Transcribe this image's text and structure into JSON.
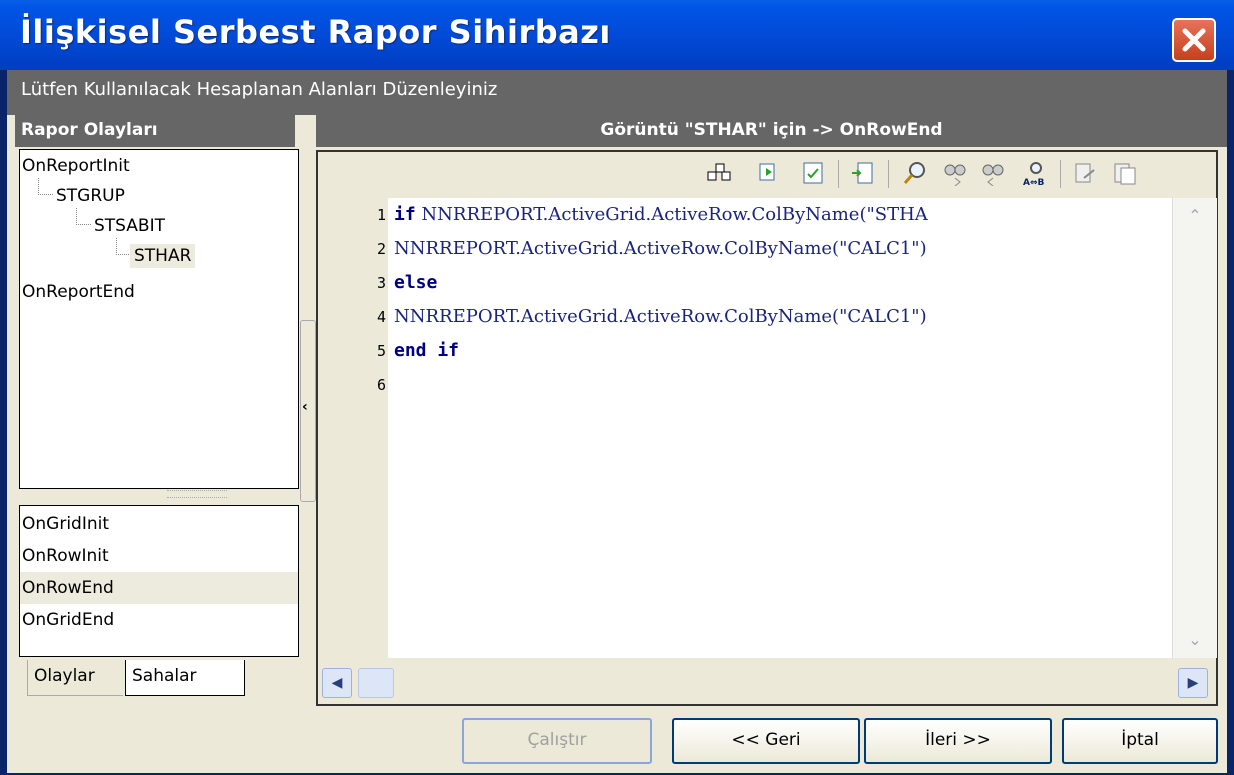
{
  "window": {
    "title": "İlişkisel Serbest Rapor Sihirbazı",
    "subtitle": "Lütfen Kullanılacak Hesaplanan Alanları Düzenleyiniz"
  },
  "left_panel": {
    "header": "Rapor Olayları",
    "tree": [
      "OnReportInit",
      "STGRUP",
      "STSABIT",
      "STHAR",
      "OnReportEnd"
    ],
    "events": [
      "OnGridInit",
      "OnRowInit",
      "OnRowEnd",
      "OnGridEnd"
    ],
    "selected_event": "OnRowEnd",
    "tabs": [
      "Olaylar",
      "Sahalar"
    ]
  },
  "editor": {
    "header": "Görüntü \"STHAR\" için -> OnRowEnd",
    "toolbar_icons": [
      "grid-icon",
      "refresh-icon",
      "checklist-icon",
      "import-icon",
      "search-icon",
      "find-next-icon",
      "find-prev-icon",
      "replace-icon",
      "copy-icon",
      "paste-icon"
    ],
    "lines": [
      {
        "n": "1",
        "kw": "if",
        "text": " NNRREPORT.ActiveGrid.ActiveRow.ColByName(\"STHA"
      },
      {
        "n": "2",
        "kw": "",
        "text": "NNRREPORT.ActiveGrid.ActiveRow.ColByName(\"CALC1\")"
      },
      {
        "n": "3",
        "kw": "else",
        "text": ""
      },
      {
        "n": "4",
        "kw": "",
        "text": "NNRREPORT.ActiveGrid.ActiveRow.ColByName(\"CALC1\")"
      },
      {
        "n": "5",
        "kw": "end if",
        "text": ""
      },
      {
        "n": "6",
        "kw": "",
        "text": ""
      }
    ]
  },
  "footer": {
    "run": "Çalıştır",
    "back": "<< Geri",
    "next": "İleri >>",
    "cancel": "İptal"
  }
}
